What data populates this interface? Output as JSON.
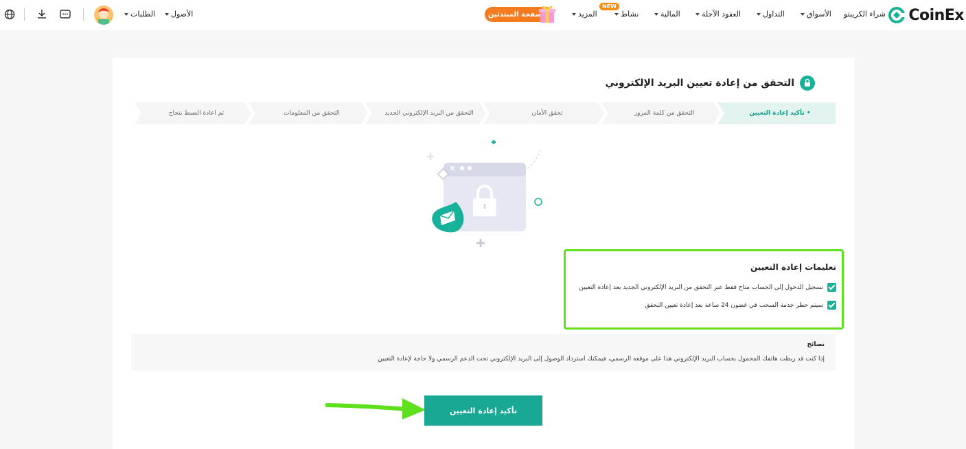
{
  "brand": {
    "name": "CoinEx",
    "accent": "#18b29a"
  },
  "header": {
    "nav": {
      "buy_crypto": "شراء الكريبتو",
      "markets": "الأسواق",
      "trade": "التداول",
      "futures": "العقود الآجلة",
      "finance": "المالية",
      "activity": "نشاط",
      "more": "المزيد",
      "new_badge": "NEW",
      "beginner": "صفحة المبتدئين",
      "assets": "الأصول",
      "orders": "الطلبات"
    }
  },
  "page": {
    "title": "التحقق من إعادة تعيين البريد الإلكتروني",
    "steps": [
      {
        "label": "تأكيد إعادة التعيين",
        "active": true
      },
      {
        "label": "التحقق من كلمة المرور"
      },
      {
        "label": "تحقق الأمان"
      },
      {
        "label": "التحقق من البريد الإلكتروني الجديد"
      },
      {
        "label": "التحقق من المعلومات"
      },
      {
        "label": "تم اعادة الضبط بنجاح"
      }
    ],
    "notice": {
      "title": "تعليمات إعادة التعيين",
      "items": [
        "تسجيل الدخول إلى الحساب متاح فقط عبر التحقق من البريد الإلكتروني الجديد بعد إعادة التعيين",
        "سيتم حظر خدمة السحب في غضون 24 ساعة بعد إعادة تعيين التحقق"
      ]
    },
    "tips": {
      "title": "نصائح",
      "text": "إذا كنت قد ربطت هاتفك المحمول بحساب البريد الإلكتروني هذا على موقعه الرسمي، فيمكنك استرداد الوصول إلى البريد الإلكتروني تحت الدعم الرسمي ولا حاجة لإعادة التعيين"
    },
    "confirm_button": "تأكيد إعادة التعيين"
  }
}
